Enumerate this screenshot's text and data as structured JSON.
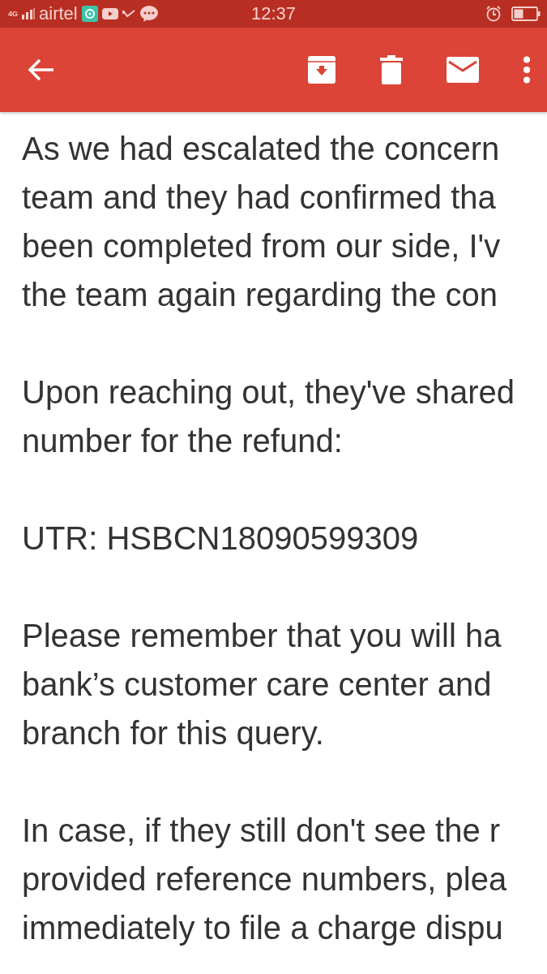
{
  "status_bar": {
    "network": "4G",
    "carrier": "airtel",
    "time": "12:37"
  },
  "message": {
    "paragraphs": [
      [
        "As we had escalated the concern",
        "team and they had confirmed tha",
        "been completed from our side, I'v",
        "the team again regarding the con"
      ],
      [
        "Upon reaching out, they've shared",
        "number for the refund:"
      ],
      [
        "UTR: HSBCN18090599309"
      ],
      [
        "Please remember that you will ha",
        "bank’s customer care center and",
        "branch for this query."
      ],
      [
        "In case, if they still don't see the r",
        "provided reference numbers, plea",
        "immediately to file a charge dispu"
      ]
    ]
  }
}
